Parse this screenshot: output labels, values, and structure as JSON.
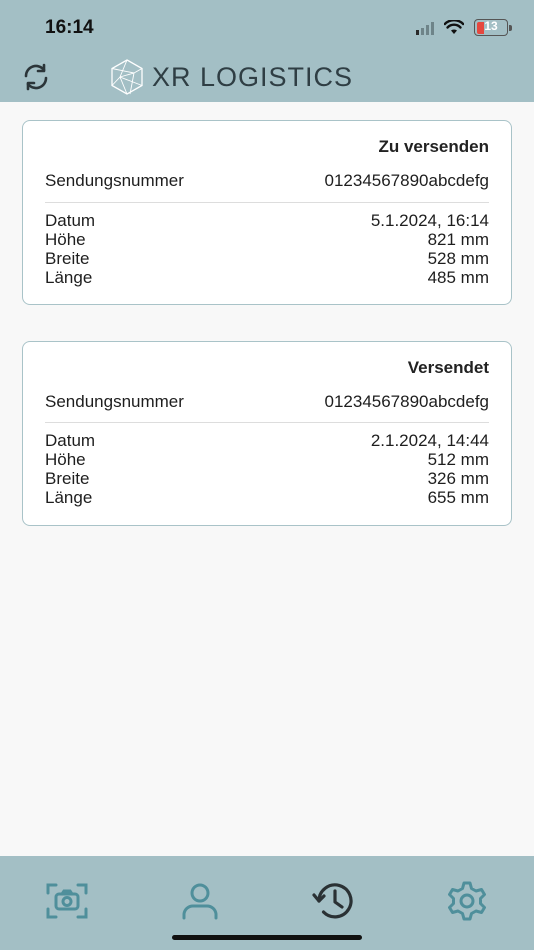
{
  "status_bar": {
    "time": "16:14",
    "battery": "13"
  },
  "header": {
    "app_title": "XR LOGISTICS",
    "refresh_icon": "refresh-icon",
    "logo_icon": "hexagon-logo-icon"
  },
  "shipments": [
    {
      "status": "Zu versenden",
      "tracking_label": "Sendungsnummer",
      "tracking_value": "01234567890abcdefg",
      "rows": [
        {
          "label": "Datum",
          "value": "5.1.2024, 16:14"
        },
        {
          "label": "Höhe",
          "value": "821 mm"
        },
        {
          "label": "Breite",
          "value": "528 mm"
        },
        {
          "label": "Länge",
          "value": "485 mm"
        }
      ]
    },
    {
      "status": "Versendet",
      "tracking_label": "Sendungsnummer",
      "tracking_value": "01234567890abcdefg",
      "rows": [
        {
          "label": "Datum",
          "value": "2.1.2024, 14:44"
        },
        {
          "label": "Höhe",
          "value": "512 mm"
        },
        {
          "label": "Breite",
          "value": "326 mm"
        },
        {
          "label": "Länge",
          "value": "655 mm"
        }
      ]
    }
  ],
  "tabbar": {
    "tabs": [
      {
        "icon": "camera-scan-icon",
        "active": false
      },
      {
        "icon": "person-icon",
        "active": false
      },
      {
        "icon": "history-icon",
        "active": true
      },
      {
        "icon": "gear-icon",
        "active": false
      }
    ]
  },
  "colors": {
    "header_bg": "#a3bfc5",
    "inactive_icon": "#4f8f9b",
    "active_icon": "#2a3134",
    "card_border": "#a9c3c8"
  }
}
